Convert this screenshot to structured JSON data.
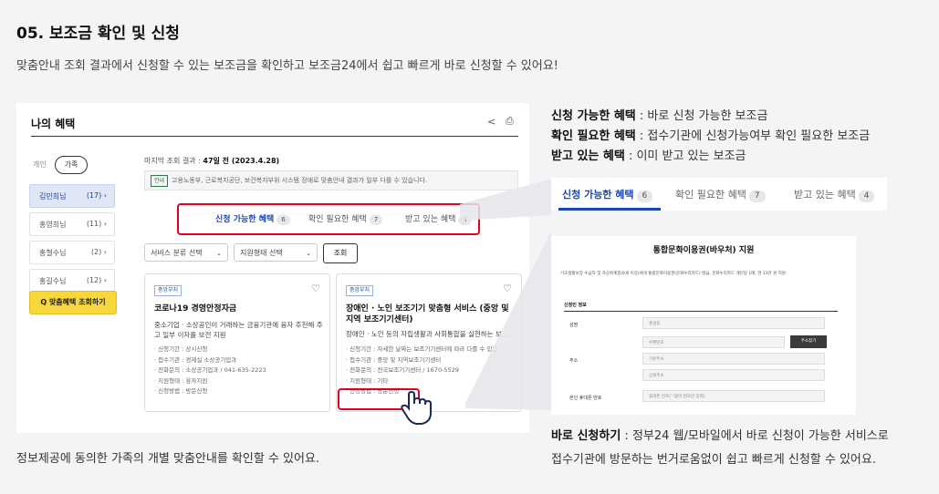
{
  "section_title": "05. 보조금 확인 및 신청",
  "section_subtitle": "맞춤안내 조회 결과에서 신청할 수 있는 보조금을 확인하고 보조금24에서 쉽고 빠르게 바로 신청할 수 있어요!",
  "bottom_caption": "정보제공에 동의한 가족의 개별 맞춤안내를 확인할 수 있어요.",
  "screen": {
    "title": "나의 혜택",
    "scope_personal": "개인",
    "scope_family": "가족",
    "members": [
      {
        "name": "김민희님",
        "count": "(17)",
        "arrow": "›"
      },
      {
        "name": "홍영희님",
        "count": "(11)",
        "arrow": "›"
      },
      {
        "name": "홍철수님",
        "count": "(2)",
        "arrow": "›"
      },
      {
        "name": "홍길수님",
        "count": "(12)",
        "arrow": "›"
      }
    ],
    "find_button": "Q 맞춤혜택 조회하기",
    "last_query_label": "마지막 조회 결과 : ",
    "last_query_value": "47일 전 (2023.4.28)",
    "notice_tag": "안내",
    "notice_text": "고용노동부, 근로복지공단, 보건복지부위 시스템 장애로 맞춤안내 결과가 일부 다를 수 있습니다.",
    "tabs": [
      {
        "label": "신청 가능한 혜택",
        "count": "6"
      },
      {
        "label": "확인 필요한 혜택",
        "count": "7"
      },
      {
        "label": "받고 있는 혜택",
        "count": "4"
      }
    ],
    "filter_service": "서비스 분류 선택",
    "filter_support": "지원형태 선택",
    "query_button": "조회",
    "cards": [
      {
        "badge": "중앙부처",
        "title": "코로나19 경영안정자금",
        "desc": "중소기업 · 소상공인이 거래하는 금융기관에 융자 추천해 주고 일부 이자를 보전 지원",
        "details": [
          "· 신청기간 : 상시신청",
          "· 접수기관 : 경제실 소상공기업과",
          "· 전화문의 : 소상공기업과 / 041-635-2223",
          "· 지원형태 : 융자지원",
          "· 신청방법 : 방문신청"
        ]
      },
      {
        "badge": "중앙부처",
        "title": "장애인 · 노인 보조기기 맞춤형 서비스 (중앙 및 지역 보조기기센터)",
        "desc": "장애인 · 노인 등의 자립생활과 사회통합을 실현하는 보...",
        "details": [
          "· 신청기간 : 자세한 날짜는 보조기기센터에 따라 다를 수 있음",
          "· 접수기관 : 중앙 및 지역보조기기센터",
          "· 전화문의 : 전국보조기기센터 / 1670-5529",
          "· 지원형태 : 기타",
          "· 신청방법 : 방문신청"
        ]
      }
    ]
  },
  "legend": [
    {
      "term": "신청 가능한 혜택",
      "desc": " : 바로 신청 가능한 보조금"
    },
    {
      "term": "확인 필요한 혜택",
      "desc": " : 접수기관에 신청가능여부 확인 필요한 보조금"
    },
    {
      "term": "받고 있는 혜택",
      "desc": " : 이미 받고 있는 보조금"
    }
  ],
  "zoom_tabs": [
    {
      "label": "신청 가능한 혜택",
      "count": "6"
    },
    {
      "label": "확인 필요한 혜택",
      "count": "7"
    },
    {
      "label": "받고 있는 혜택",
      "count": "4"
    }
  ],
  "form": {
    "title": "통합문화이용권(바우처) 지원",
    "desc": "기초생활보장 수급자 및 차상위계층(6세 이상)에게 통합문화이용권(문화누리카드) 발급, 문화누리카드 개인당 1매, 연 13만 원 지원",
    "section": "신청인 정보",
    "label_name": "성명",
    "value_name": "홍길동",
    "label_address": "주소",
    "placeholder_zip": "우편번호",
    "button_zip": "주소찾기",
    "placeholder_addr1": "기본주소",
    "placeholder_addr2": "상세주소",
    "label_phone": "본인 휴대폰 번호",
    "placeholder_phone": "휴대폰 번호('-'없이 번호만 입력)"
  },
  "right_desc": {
    "term": "바로 신청하기",
    "line1": " : 정부24 웹/모바일에서 바로 신청이 가능한 서비스로",
    "line2": "접수기관에 방문하는 번거로움없이 쉽고 빠르게 신청할 수 있어요."
  },
  "colors": {
    "accent_blue": "#1a47b8",
    "highlight_red": "#e3001b",
    "button_yellow": "#f8d73d"
  }
}
